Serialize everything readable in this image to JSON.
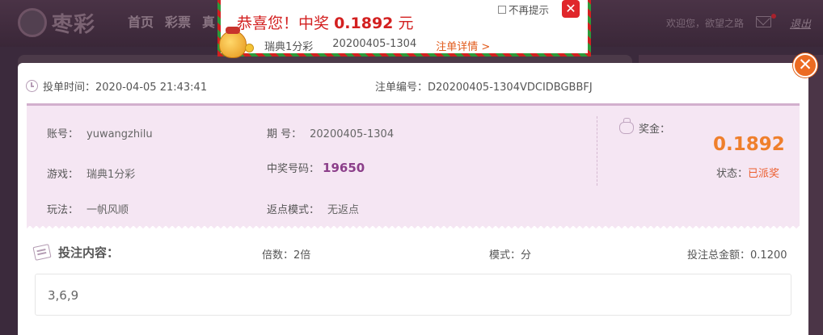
{
  "nav": {
    "logo_text": "枣彩",
    "items": [
      "首页",
      "彩票",
      "真"
    ],
    "welcome": "欢迎您，欲望之路",
    "logout": "退出"
  },
  "popup": {
    "title_prefix": "恭喜您！中奖",
    "amount": "0.1892",
    "unit": "元",
    "game": "瑞典1分彩",
    "issue": "20200405-1304",
    "detail_link": "注单详情 >",
    "no_remind": "不再提示",
    "close": "✕"
  },
  "modal": {
    "close": "✕",
    "bet_time_label": "投单时间：",
    "bet_time": "2020-04-05 21:43:41",
    "order_no_label": "注单编号：",
    "order_no": "D20200405-1304VDCIDBGBBFJ",
    "account_label": "账号：",
    "account": "yuwangzhilu",
    "game_label": "游戏：",
    "game": "瑞典1分彩",
    "play_label": "玩法：",
    "play": "一帆风顺",
    "issue_label": "期 号：",
    "issue": "20200405-1304",
    "win_no_label": "中奖号码：",
    "win_no": "19650",
    "rebate_label": "返点模式：",
    "rebate": "无返点",
    "prize_label": "奖金：",
    "prize": "0.1892",
    "status_label": "状态：",
    "status": "已派奖",
    "content_title": "投注内容：",
    "multiple_label": "倍数：",
    "multiple": "2倍",
    "mode_label": "模式：",
    "mode": "分",
    "total_label": "投注总金额：",
    "total": "0.1200",
    "numbers": "3,6,9"
  },
  "colors": {
    "accent_orange": "#ef7f2c",
    "status_red": "#ec5e2e",
    "panel_pink": "#f5e6f3",
    "popup_red": "#d32020"
  }
}
